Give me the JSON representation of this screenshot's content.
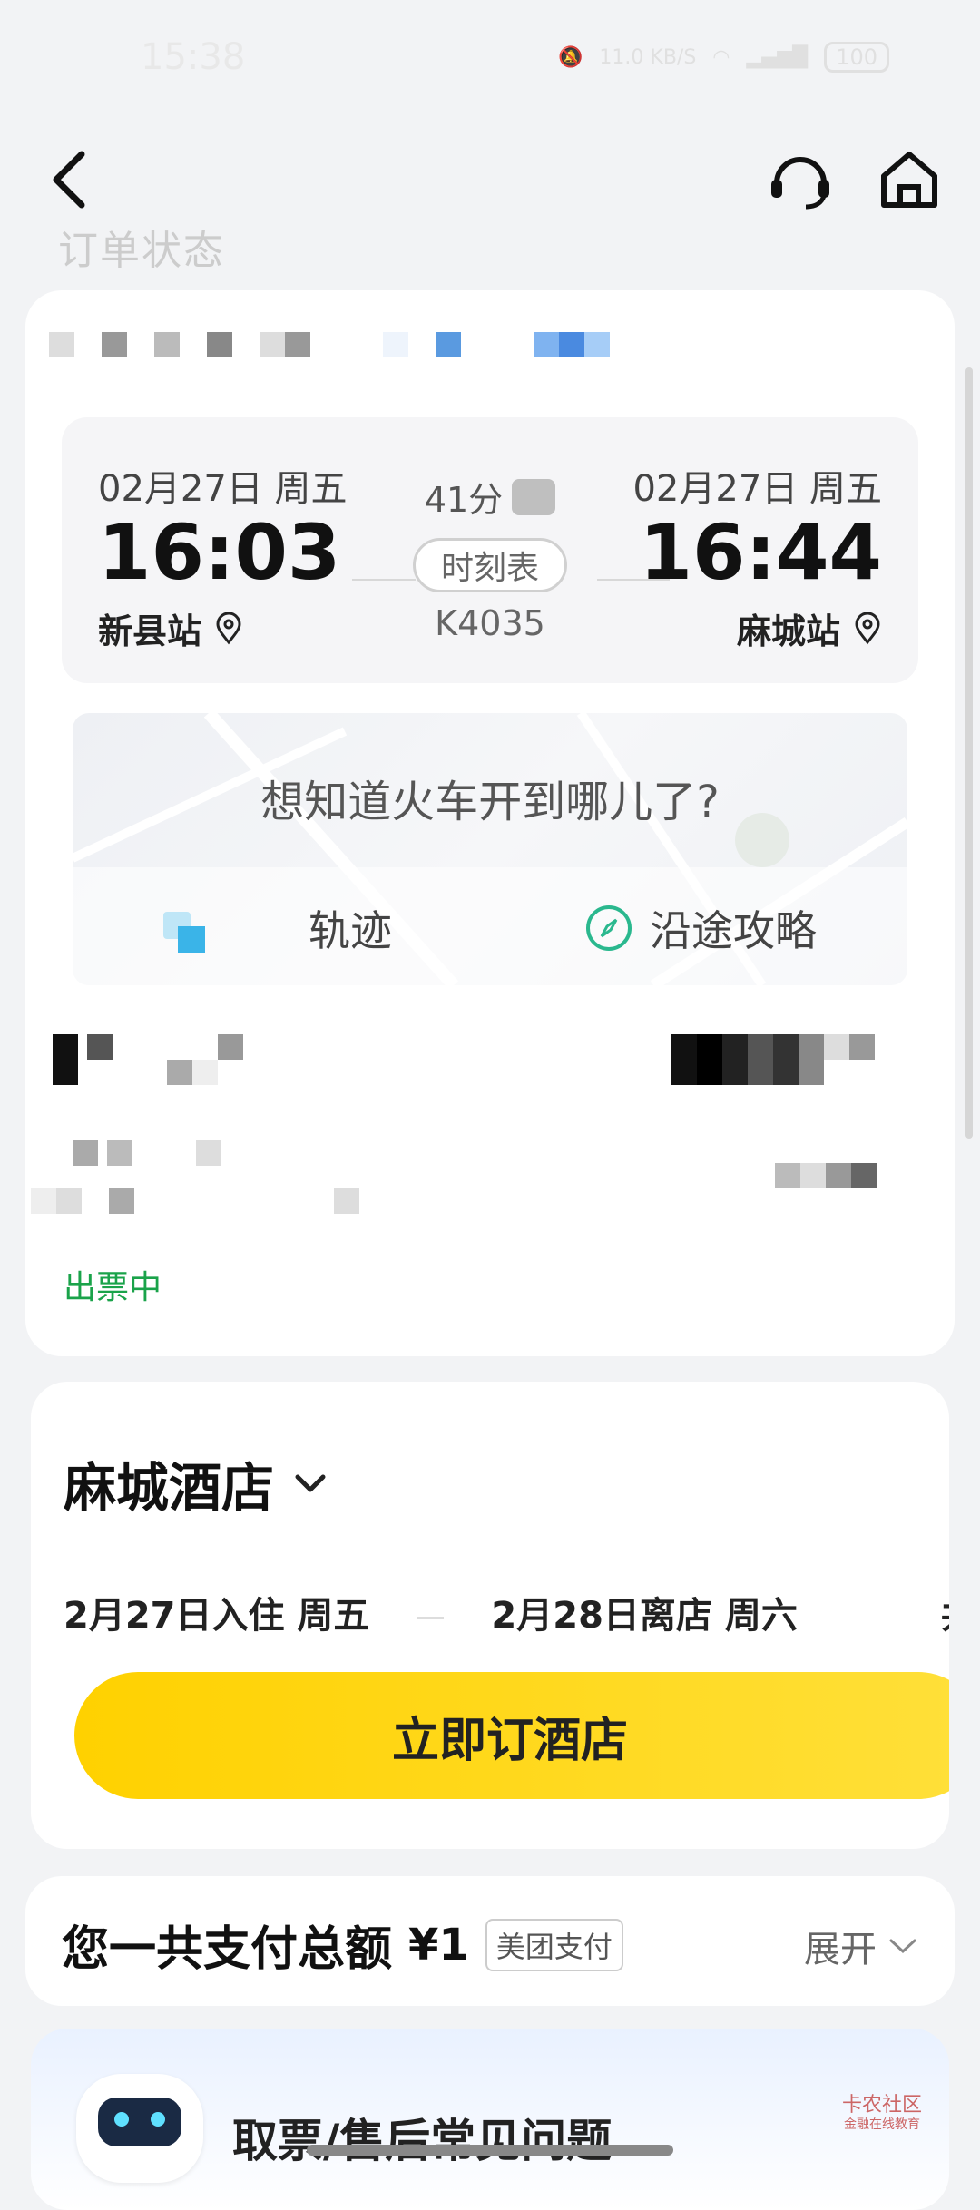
{
  "status_bar": {
    "time": "15:38",
    "net_speed": "11.0 KB/S",
    "battery": "100"
  },
  "page": {
    "peek_title": "订单状态"
  },
  "train": {
    "dep_date": "02月27日 周五",
    "dep_time": "16:03",
    "dep_station": "新县站",
    "duration": "41分",
    "schedule_label": "时刻表",
    "train_no": "K4035",
    "arr_date": "02月27日 周五",
    "arr_time": "16:44",
    "arr_station": "麻城站"
  },
  "map": {
    "question": "想知道火车开到哪儿了?",
    "track_label": "轨迹",
    "guide_label": "沿途攻略"
  },
  "ticket": {
    "status": "出票中",
    "status_color": "#1aa34a"
  },
  "hotel": {
    "title": "麻城酒店",
    "checkin": "2月27日入住 周五",
    "checkout": "2月28日离店 周六",
    "total_peek": "共",
    "book_label": "立即订酒店",
    "accent": "#ffd100"
  },
  "payment": {
    "label": "您一共支付总额",
    "amount": "¥1",
    "method": "美团支付",
    "expand_label": "展开"
  },
  "faq": {
    "title": "取票/售后常见问题",
    "watermark_line1": "卡农社区",
    "watermark_line2": "金融在线教育"
  }
}
